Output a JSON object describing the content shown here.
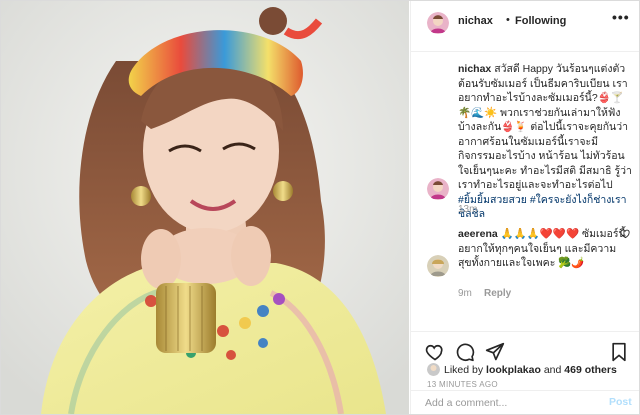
{
  "post": {
    "username": "nichax",
    "separator": "•",
    "follow_status": "Following",
    "more_label": "•••"
  },
  "caption": {
    "username": "nichax",
    "text": "สวัสดี Happy วันร้อนๆแต่งตัวต้อนรับซัมเมอร์ เป็นธีมคาริบเบียน เราอยากทำอะไรบ้างละซัมเมอร์นี้?👙🍸🌴🌊☀️ พวกเราช่วยกันเล่ามาให้ฟังบ้างละกัน👙🍹 ต่อไปนี้เราจะคุยกันว่าอากาศร้อนในซัมเมอร์นี้เราจะมีกิจกรรมอะไรบ้าง หน้าร้อน ไม่ทัวร้อน ใจเย็นๆนะคะ ทำอะไรมีสติ มีสมาธิ รู้ว่าเราทำอะไรอยู่และจะทำอะไรต่อไป",
    "hashtags": "#ยิ้มยิ้มสวยสวย #ใครจะยังไงก็ช่างเราชิลชิล",
    "time": "13m"
  },
  "comment": {
    "username": "aeerena",
    "text": "🙏🙏🙏❤️❤️❤️ ซัมเมอร์นี้อยากให้ทุกๆคนใจเย็นๆ และมีความสุขทั้งกายและใจเพคะ 🥦🌶️",
    "time": "9m",
    "reply_label": "Reply"
  },
  "likes": {
    "prefix": "Liked by",
    "user": "lookplakao",
    "and": "and",
    "others": "469 others"
  },
  "timestamp": "13 MINUTES AGO",
  "add_comment": {
    "placeholder": "Add a comment...",
    "post_label": "Post"
  },
  "icons": {
    "like": "heart-icon",
    "comment": "comment-bubble-icon",
    "share": "share-arrow-icon",
    "save": "bookmark-icon",
    "more": "more-dots-icon"
  },
  "colors": {
    "link": "#003569",
    "muted": "#999999",
    "post_button": "#b2dffc",
    "border": "#dbdbdb"
  }
}
